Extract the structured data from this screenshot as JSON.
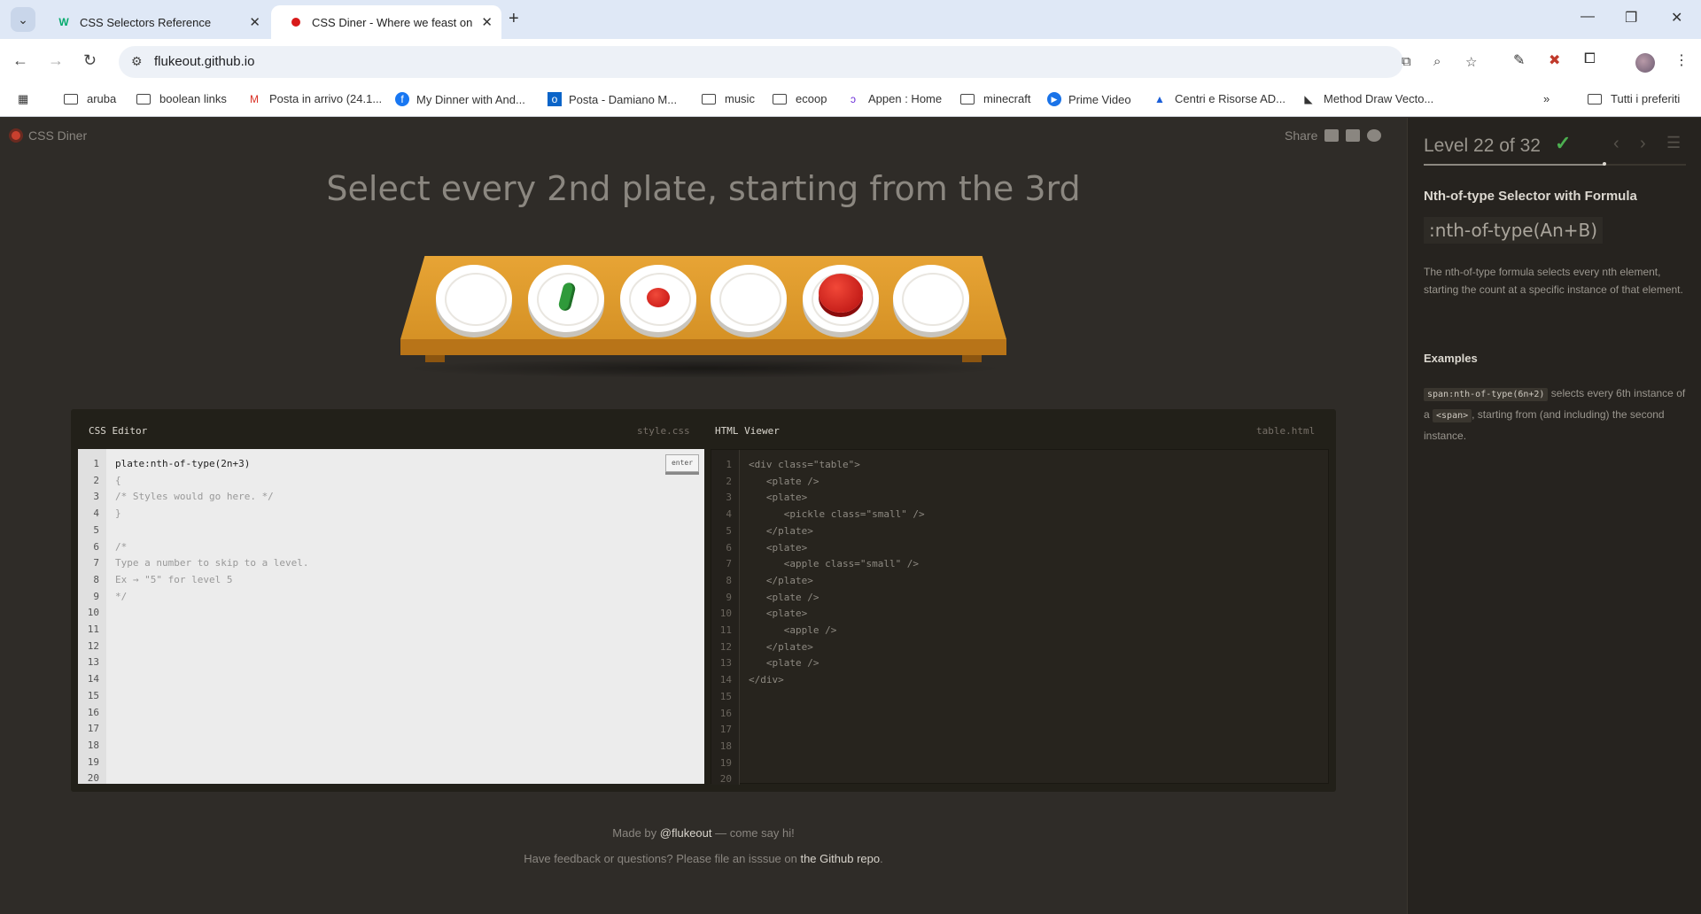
{
  "browser": {
    "tabs": [
      {
        "title": "CSS Selectors Reference",
        "favicon": "W"
      },
      {
        "title": "CSS Diner - Where we feast on",
        "favicon": "red-dot"
      }
    ],
    "url": "flukeout.github.io",
    "bookmarks": [
      {
        "label": "aruba",
        "icon": "folder-icon"
      },
      {
        "label": "boolean links",
        "icon": "folder-icon"
      },
      {
        "label": "Posta in arrivo (24.1...",
        "icon": "gmail-icon"
      },
      {
        "label": "My Dinner with And...",
        "icon": "facebook-icon"
      },
      {
        "label": "Posta - Damiano M...",
        "icon": "outlook-icon"
      },
      {
        "label": "music",
        "icon": "folder-icon"
      },
      {
        "label": "ecoop",
        "icon": "folder-icon"
      },
      {
        "label": "Appen : Home",
        "icon": "appen-icon"
      },
      {
        "label": "minecraft",
        "icon": "folder-icon"
      },
      {
        "label": "Prime Video",
        "icon": "prime-video-icon"
      },
      {
        "label": "Centri e Risorse AD...",
        "icon": "adobe-icon"
      },
      {
        "label": "Method Draw Vecto...",
        "icon": "method-draw-icon"
      }
    ],
    "all_bookmarks_label": "Tutti i preferiti"
  },
  "page": {
    "logo_text": "CSS Diner",
    "share_label": "Share",
    "instruction": "Select every 2nd plate, starting from the 3rd",
    "editor": {
      "css_title": "CSS Editor",
      "css_file": "style.css",
      "html_title": "HTML Viewer",
      "html_file": "table.html",
      "enter_label": "enter",
      "css_input": "plate:nth-of-type(2n+3)",
      "css_lines": [
        "{",
        "/* Styles would go here. */",
        "}",
        "",
        "/*",
        "Type a number to skip to a level.",
        "Ex → \"5\" for level 5",
        "*/"
      ],
      "html_lines": [
        "<div class=\"table\">",
        "   <plate />",
        "   <plate>",
        "      <pickle class=\"small\" />",
        "   </plate>",
        "   <plate>",
        "      <apple class=\"small\" />",
        "   </plate>",
        "   <plate />",
        "   <plate>",
        "      <apple />",
        "   </plate>",
        "   <plate />",
        "</div>"
      ],
      "line_count": 20
    },
    "footer": {
      "made_by_prefix": "Made by ",
      "made_by_link": "@flukeout",
      "made_by_suffix": " — come say hi!",
      "feedback_prefix": "Have feedback or questions? Please file an isssue on ",
      "feedback_link": "the Github repo",
      "feedback_suffix": "."
    }
  },
  "sidebar": {
    "level_text": "Level 22 of 32",
    "level_current": 22,
    "level_total": 32,
    "completed": true,
    "selector_name": "Nth-of-type Selector with Formula",
    "syntax": ":nth-of-type(An+B)",
    "hint": "The nth-of-type formula selects every nth element, starting the count at a specific instance of that element.",
    "examples_title": "Examples",
    "example_code": "span:nth-of-type(6n+2)",
    "example_text_1": " selects every 6th instance of a ",
    "example_code_2": "<span>",
    "example_text_2": ", starting from (and including) the second instance."
  },
  "colors": {
    "background": "#2f2c28",
    "table": "#e09a2c",
    "accent_check": "#4caf50",
    "apple": "#d81a1a",
    "pickle": "#2f9a3a"
  }
}
